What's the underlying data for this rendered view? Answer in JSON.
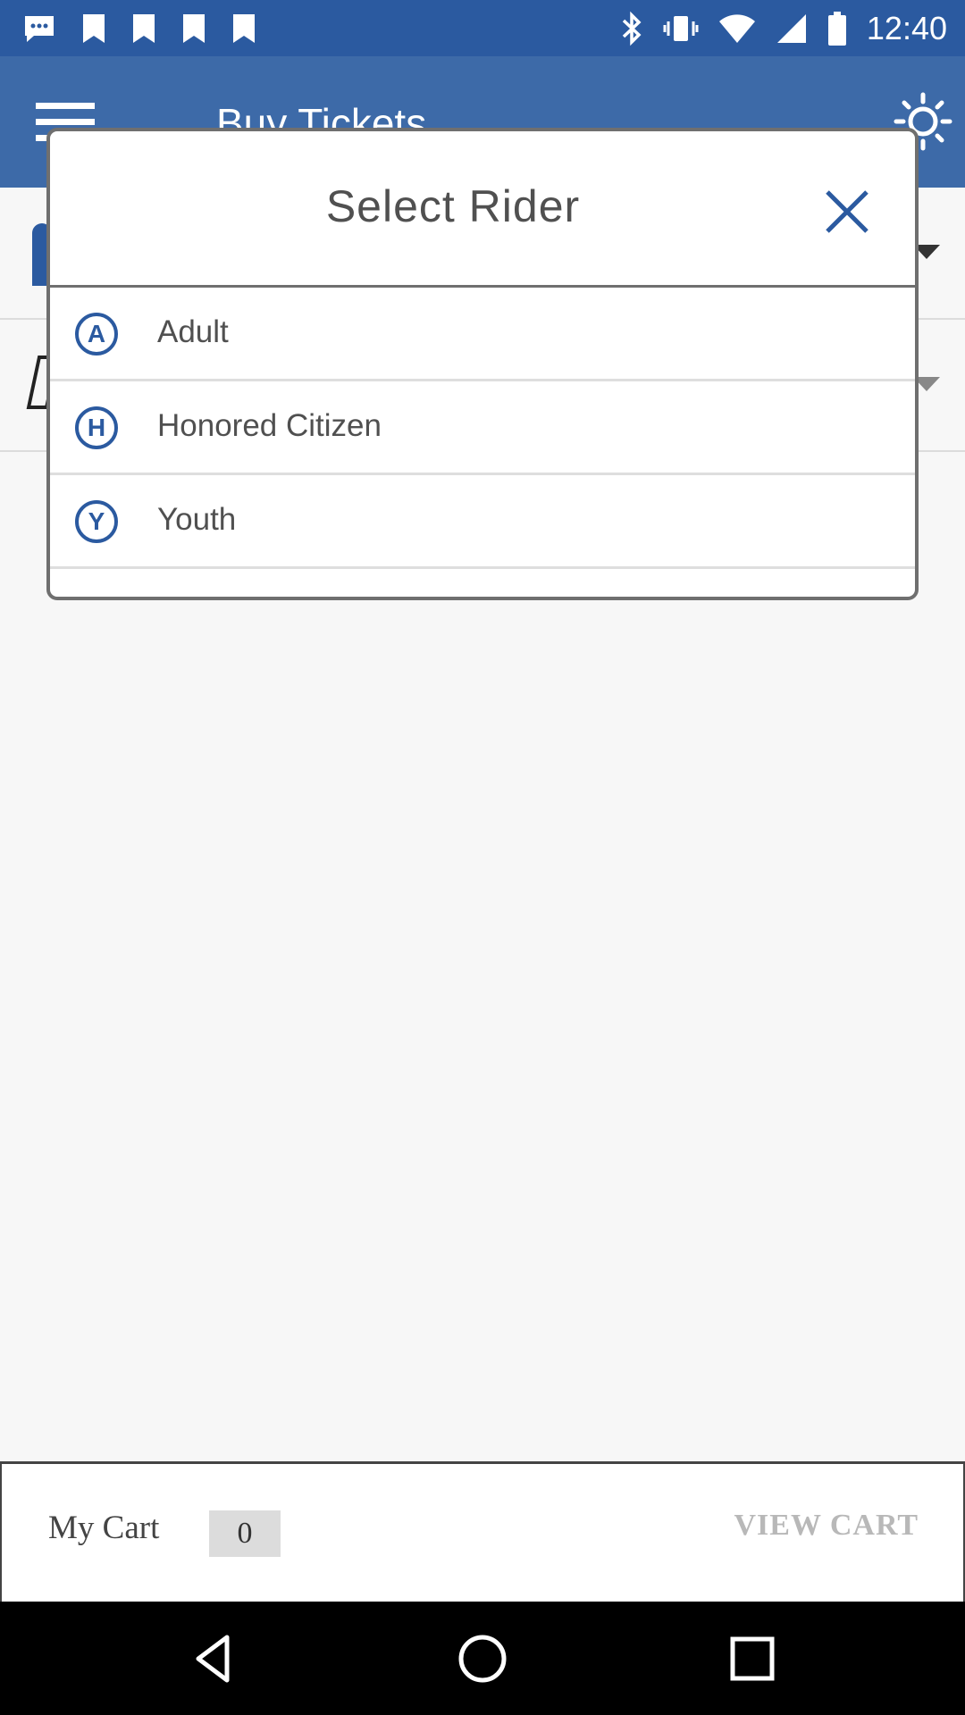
{
  "status_bar": {
    "time": "12:40",
    "icons": [
      "messages-icon",
      "notification-icon",
      "notification-icon",
      "notification-icon",
      "notification-icon",
      "bluetooth-icon",
      "vibrate-icon",
      "wifi-icon",
      "signal-icon",
      "battery-icon"
    ]
  },
  "app_bar": {
    "title": "Buy Tickets",
    "menu_icon": "hamburger-menu-icon",
    "action_icon": "brightness-icon"
  },
  "dialog": {
    "title": "Select Rider",
    "close_icon": "close-icon",
    "riders": [
      {
        "badge": "A",
        "label": "Adult"
      },
      {
        "badge": "H",
        "label": "Honored Citizen"
      },
      {
        "badge": "Y",
        "label": "Youth"
      }
    ]
  },
  "cart": {
    "label": "My Cart",
    "count": "0",
    "view_cart_label": "VIEW CART"
  },
  "colors": {
    "primary": "#3d6aa8",
    "status_bar": "#2b5aa0",
    "badge": "#2b5aa0"
  }
}
